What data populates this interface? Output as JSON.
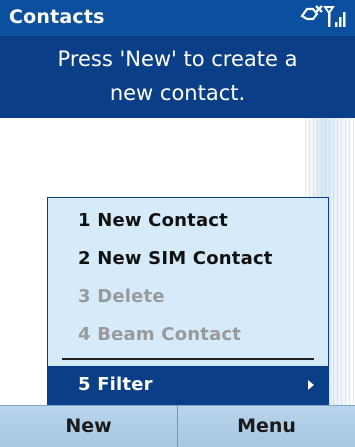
{
  "titlebar": {
    "title": "Contacts",
    "status_icons": [
      "no-connection-icon",
      "signal-strength-icon"
    ]
  },
  "message": {
    "line1": "Press 'New' to create a",
    "line2": "new contact."
  },
  "menu": {
    "items": [
      {
        "label": "1 New Contact",
        "state": "enabled"
      },
      {
        "label": "2 New SIM Contact",
        "state": "enabled"
      },
      {
        "label": "3 Delete",
        "state": "disabled"
      },
      {
        "label": "4 Beam Contact",
        "state": "disabled"
      },
      {
        "label": "5 Filter",
        "state": "selected",
        "has_submenu": true
      }
    ]
  },
  "softkeys": {
    "left": "New",
    "right": "Menu"
  },
  "colors": {
    "titlebar": "#0b4f9f",
    "message_bg": "#0a3f87",
    "menu_bg": "#d5ebf9",
    "selected_bg": "#0a3f87",
    "disabled_text": "#9a9a9a",
    "softbar": "#b9d5ec"
  }
}
